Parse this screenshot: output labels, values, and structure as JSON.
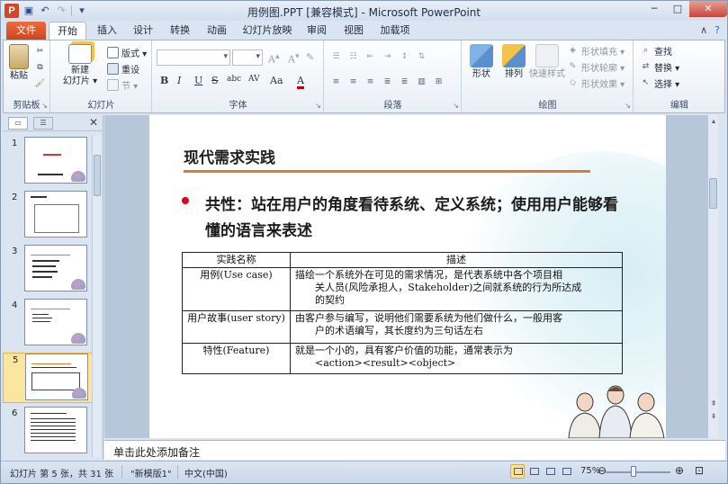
{
  "window": {
    "title": "用例图.PPT [兼容模式] - Microsoft PowerPoint",
    "app_letter": "P"
  },
  "tabs": {
    "file": "文件",
    "items": [
      "开始",
      "插入",
      "设计",
      "转换",
      "动画",
      "幻灯片放映",
      "审阅",
      "视图",
      "加载项"
    ]
  },
  "ribbon": {
    "clipboard": {
      "label": "剪贴板",
      "paste": "粘贴"
    },
    "slides": {
      "label": "幻灯片",
      "new_slide_1": "新建",
      "new_slide_2": "幻灯片 ▾",
      "layout": "版式 ▾",
      "reset": "重设",
      "section": "节 ▾"
    },
    "font": {
      "label": "字体",
      "bold": "B",
      "italic": "I",
      "underline": "U",
      "strike": "S",
      "shadow": "abc",
      "spacing": "AV",
      "case": "Aa",
      "color": "A"
    },
    "paragraph": {
      "label": "段落"
    },
    "drawing": {
      "label": "绘图",
      "shape": "形状",
      "arrange": "排列",
      "quick_style": "快速样式",
      "fill": "形状填充 ▾",
      "outline": "形状轮廓 ▾",
      "effect": "形状效果 ▾"
    },
    "editing": {
      "label": "编辑",
      "find": "查找",
      "replace": "替换 ▾",
      "select": "选择 ▾"
    }
  },
  "slides": [
    1,
    2,
    3,
    4,
    5,
    6
  ],
  "selected_slide": 5,
  "slide": {
    "title": "现代需求实践",
    "bullet": "共性：站在用户的角度看待系统、定义系统；使用用户能够看懂的语言来表述",
    "table": {
      "headers": [
        "实践名称",
        "描述"
      ],
      "rows": [
        {
          "name": "用例(Use case)",
          "desc_1": "描绘一个系统外在可见的需求情况，是代表系统中各个项目相",
          "desc_2": "关人员(风险承担人，Stakeholder)之间就系统的行为所达成",
          "desc_3": "的契约"
        },
        {
          "name": "用户故事(user story)",
          "desc_1": "由客户参与编写，说明他们需要系统为他们做什么，一般用客",
          "desc_2": "户的术语编写，其长度约为三句话左右",
          "desc_3": ""
        },
        {
          "name": "特性(Feature)",
          "desc_1": "就是一个小的，具有客户价值的功能，通常表示为",
          "desc_2": "<action><result><object>",
          "desc_3": ""
        }
      ]
    }
  },
  "notes": "单击此处添加备注",
  "status": {
    "slide_info": "幻灯片 第 5 张，共 31 张",
    "theme": "\"新模版1\"",
    "language": "中文(中国)",
    "zoom": "75%"
  },
  "colors": {
    "file_tab": "#d24726",
    "accent_rule": "#e07a2a",
    "bullet": "#e2001a",
    "selected_thumb": "#fbe59f"
  }
}
